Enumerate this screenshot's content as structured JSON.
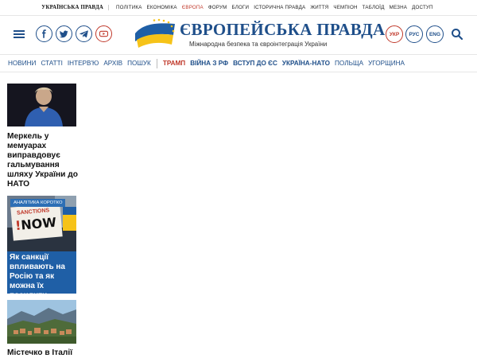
{
  "network": {
    "brand": "УКРАЇНСЬКА ПРАВДА",
    "links": [
      "ПОЛІТИКА",
      "ЕКОНОМІКА",
      "ЄВРОПА",
      "ФОРУМ",
      "БЛОГИ",
      "ІСТОРИЧНА ПРАВДА",
      "ЖИТТЯ",
      "ЧЕМПІОН",
      "ТАБЛОЇД",
      "МЕЗНА",
      "ДОСТУП"
    ],
    "active": "ЄВРОПА"
  },
  "header": {
    "title": "ЄВРОПЕЙСЬКА ПРАВДА",
    "subtitle": "Міжнародна безпека та євроінтеграція України",
    "socials": [
      "facebook-icon",
      "twitter-icon",
      "telegram-icon",
      "youtube-icon"
    ],
    "languages": [
      {
        "label": "УКР",
        "active": true
      },
      {
        "label": "РУС",
        "active": false
      },
      {
        "label": "ENG",
        "active": false
      }
    ]
  },
  "nav": {
    "left": [
      "НОВИНИ",
      "СТАТТІ",
      "ІНТЕРВ'Ю",
      "АРХІВ",
      "ПОШУК"
    ],
    "right": [
      {
        "label": "ТРАМП",
        "style": "red"
      },
      {
        "label": "ВІЙНА З РФ",
        "style": "bold"
      },
      {
        "label": "ВСТУП ДО ЄС",
        "style": "bold"
      },
      {
        "label": "УКРАЇНА-НАТО",
        "style": "bold"
      },
      {
        "label": "ПОЛЬЩА",
        "style": "plain"
      },
      {
        "label": "УГОРЩИНА",
        "style": "plain"
      }
    ]
  },
  "articles": {
    "first": {
      "title": "Меркель у мемуарах виправдовує гальмування шляху України до НАТО"
    },
    "second": {
      "badge": "АНАЛІТИКА КОРОТКО",
      "sign_text": "SANCTIONS NOW",
      "title": "Як санкції впливають на Росію та як можна їх посилити"
    },
    "third": {
      "title": "Містечко в Італії"
    }
  },
  "colors": {
    "brand_blue": "#1f4f8a",
    "accent_red": "#c0392b",
    "card_blue": "#1f5fa6"
  }
}
